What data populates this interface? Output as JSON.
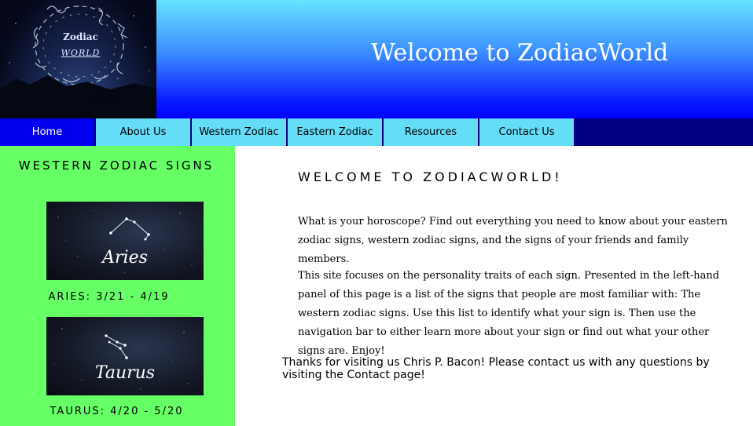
{
  "header": {
    "logo_line1": "Zodiac",
    "logo_line2": "WORLD",
    "title": "Welcome to ZodiacWorld"
  },
  "nav": {
    "items": [
      {
        "label": "Home",
        "active": true
      },
      {
        "label": "About Us"
      },
      {
        "label": "Western Zodiac"
      },
      {
        "label": "Eastern Zodiac"
      },
      {
        "label": "Resources"
      },
      {
        "label": "Contact Us"
      }
    ]
  },
  "sidebar": {
    "title": "WESTERN ZODIAC SIGNS",
    "signs": [
      {
        "image_label": "Aries",
        "caption": "ARIES: 3/21 - 4/19"
      },
      {
        "image_label": "Taurus",
        "caption": "TAURUS: 4/20 - 5/20"
      }
    ]
  },
  "main": {
    "heading": "WELCOME TO ZODIACWORLD!",
    "paragraph1": "What is your horoscope? Find out everything you need to know about your eastern zodiac signs, western zodiac signs, and the signs of your friends and family members.",
    "paragraph2": "This site focuses on the personality traits of each sign. Presented in the left-hand panel of this page is a list of the signs that people are most familiar with: The western zodiac signs. Use this list to identify what your sign is. Then use the navigation bar to either learn more about your sign or find out what your other signs are. Enjoy!",
    "thanks": "Thanks for visiting us Chris P. Bacon! Please contact us with any questions by visiting the Contact page!"
  },
  "colors": {
    "nav_bar": "#000080",
    "nav_active": "#0000ee",
    "nav_button": "#66ddf7",
    "sidebar": "#66ff66"
  }
}
